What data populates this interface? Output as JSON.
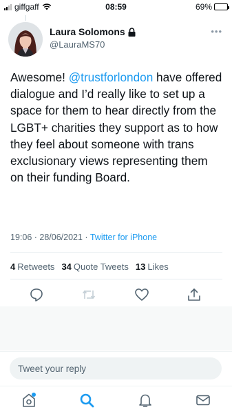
{
  "status_bar": {
    "carrier": "giffgaff",
    "time": "08:59",
    "battery": "69%",
    "battery_level": 0.69
  },
  "tweet": {
    "author": {
      "display_name": "Laura Solomons",
      "handle": "@LauraMS70",
      "protected": true
    },
    "text_parts": [
      "Awesome! ",
      "@trustforlondon",
      " have offered dialogue and I’d really like to set up a space for them to hear directly from the LGBT+ charities they support as to how they feel about someone with trans exclusionary views representing them on their funding Board."
    ],
    "timestamp": "19:06 · 28/06/2021 · ",
    "source": "Twitter for iPhone",
    "stats": {
      "retweets_count": "4",
      "retweets_label": "Retweets",
      "quotes_count": "34",
      "quotes_label": "Quote Tweets",
      "likes_count": "13",
      "likes_label": "Likes"
    },
    "actions": [
      "reply-icon",
      "retweet-icon",
      "like-icon",
      "share-icon"
    ]
  },
  "reply": {
    "placeholder": "Tweet your reply"
  },
  "tabbar": {
    "tabs": [
      "home-icon",
      "search-icon",
      "notifications-icon",
      "messages-icon"
    ]
  },
  "colors": {
    "accent": "#1d9bf0",
    "text": "#0f1419",
    "secondary": "#536471"
  }
}
